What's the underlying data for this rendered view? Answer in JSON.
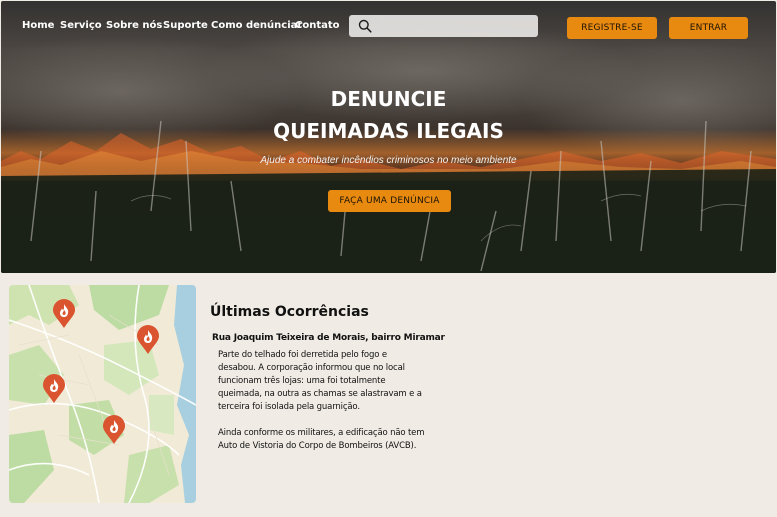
{
  "nav": {
    "items": [
      {
        "label": "Home"
      },
      {
        "label": "Serviço"
      },
      {
        "label": "Sobre nós"
      },
      {
        "label": "Suporte"
      },
      {
        "label": "Como denúnciar"
      },
      {
        "label": "Contato"
      }
    ]
  },
  "search": {
    "placeholder": "",
    "icon": "search-icon"
  },
  "auth": {
    "register_label": "REGISTRE-SE",
    "login_label": "ENTRAR"
  },
  "hero": {
    "title_line1": "DENUNCIE",
    "title_line2": "QUEIMADAS ILEGAIS",
    "subtitle": "Ajude a combater incêndios criminosos no meio ambiente",
    "cta_label": "FAÇA UMA DENÚNCIA"
  },
  "map": {
    "marker_icon": "fire-marker-icon",
    "markers_count": 4
  },
  "occurrences": {
    "title": "Últimas Ocorrências",
    "address": "Rua Joaquim Teixeira de Morais, bairro Miramar",
    "paragraph1_lines": [
      "Parte do telhado foi derretida pelo fogo e",
      "desabou. A corporação informou que no local",
      "funcionam três lojas: uma foi totalmente",
      "queimada, na outra as chamas se alastravam e a",
      "terceira foi isolada pela guarnição."
    ],
    "paragraph2_lines": [
      "Ainda conforme os militares, a edificação não tem",
      "Auto de Vistoria do Corpo de Bombeiros (AVCB)."
    ]
  },
  "colors": {
    "accent": "#e88a10",
    "background": "#f0ebe4",
    "marker": "#d9542f"
  }
}
